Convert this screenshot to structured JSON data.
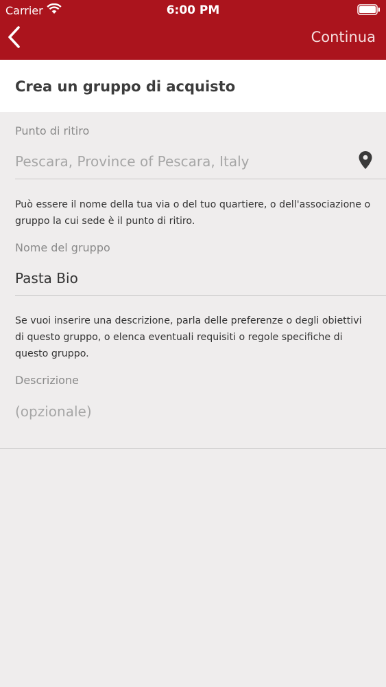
{
  "status_bar": {
    "carrier": "Carrier",
    "time": "6:00 PM"
  },
  "nav": {
    "continue_label": "Continua"
  },
  "header": {
    "title": "Crea un gruppo di acquisto"
  },
  "pickup": {
    "label": "Punto di ritiro",
    "value": "Pescara, Province of Pescara, Italy",
    "icon": "location-pin-icon"
  },
  "group_name": {
    "help": "Può essere il nome della tua via o del tuo quartiere, o dell'associazione o gruppo la cui sede è il punto di ritiro.",
    "label": "Nome del gruppo",
    "value": "Pasta Bio"
  },
  "description": {
    "help": "Se vuoi inserire una descrizione, parla delle preferenze o degli obiettivi di questo gruppo, o elenca eventuali requisiti o regole specifiche di questo gruppo.",
    "label": "Descrizione",
    "placeholder": "(opzionale)"
  },
  "colors": {
    "brand_red": "#ab141d",
    "background": "#efeded",
    "header_card": "#ffffff"
  }
}
